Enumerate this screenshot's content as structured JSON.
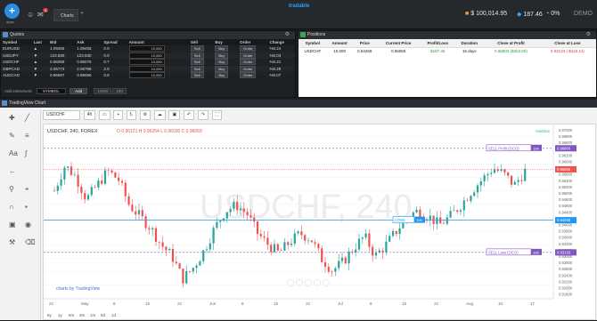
{
  "topbar": {
    "app_label": "apps",
    "notification_count": "3",
    "tab_label": "Charts",
    "brand": "tradable",
    "balance": "$ 100,014.95",
    "equity": "187.46",
    "margin_pct": "0%",
    "mode": "DEMO"
  },
  "quotes": {
    "title": "Quotes",
    "columns": [
      "Symbol",
      "Last",
      "Bid",
      "Ask",
      "Spread",
      "Amount",
      "Sell",
      "Buy",
      "Order",
      "Change"
    ],
    "rows": [
      {
        "symbol": "EURUSD",
        "dir": "up",
        "bid": "1.09455",
        "ask": "1.09455",
        "spread": "0.0",
        "amount": "10,000",
        "change": "%0.24",
        "chg_dir": "up"
      },
      {
        "symbol": "USDJPY",
        "dir": "down",
        "bid": "123.930",
        "ask": "123.930",
        "spread": "0.0",
        "amount": "10,000",
        "change": "%0.03",
        "chg_dir": "up"
      },
      {
        "symbol": "USDCHF",
        "dir": "up",
        "bid": "0.96069",
        "ask": "0.96076",
        "spread": "0.7",
        "amount": "10,000",
        "change": "%0.21",
        "chg_dir": "up"
      },
      {
        "symbol": "GBPCAD",
        "dir": "down",
        "bid": "2.06773",
        "ask": "2.06798",
        "spread": "2.5",
        "amount": "10,000",
        "change": "%0.29",
        "chg_dir": "up"
      },
      {
        "symbol": "AUDCAD",
        "dir": "down",
        "bid": "0.96697",
        "ask": "0.96066",
        "spread": "0.9",
        "amount": "10,000",
        "change": "%0.07",
        "chg_dir": "down"
      }
    ],
    "sell_label": "Sell",
    "buy_label": "Buy",
    "order_label": "Order",
    "add_label": "Add Instrument:",
    "symbol_placeholder": "SYMBOL",
    "add_button": "Add",
    "small_a": "1W40",
    "small_b": "100"
  },
  "positions": {
    "title": "Positions",
    "columns": [
      "Symbol",
      "Amount",
      "Price",
      "Current Price",
      "Profit/Loss",
      "Duration",
      "Close at Profit",
      "Close at Loss"
    ],
    "rows": [
      {
        "symbol": "USDCHF",
        "amount": "10,000",
        "price": "0.94268",
        "current": "0.96065",
        "pl": "$187.46",
        "duration": "15 days",
        "close_profit": "0.96800 ($263.50)",
        "close_loss": "0.93133 (-$118.14)"
      }
    ]
  },
  "chart": {
    "panel_title": "TradingView Chart",
    "symbol_box": "USDCHF",
    "interval": "4h",
    "legend_symbol": "USDCHF, 240, FOREX",
    "ohlc": "O 0.96121  H 0.96254  L 0.96030  C 0.96059",
    "watermark": "USDCHF, 240",
    "realtime_label": "realtime",
    "powered_by": "charts by TradingView",
    "sell_profit_label": "SELL Profit (OCO)",
    "sell_loss_label": "SELL Loss (OCO)",
    "long_label": "LONG",
    "qty": "10K",
    "price_axis": [
      "0.97000",
      "0.96800",
      "0.96600",
      "0.96400",
      "0.96200",
      "0.96000",
      "0.95800",
      "0.95600",
      "0.95400",
      "0.95200",
      "0.95000",
      "0.94800",
      "0.94600",
      "0.94400",
      "0.94200",
      "0.94000",
      "0.93800",
      "0.93600",
      "0.93400",
      "0.93200",
      "0.93000",
      "0.92800",
      "0.92600",
      "0.92400",
      "0.92200",
      "0.92000",
      "0.91800",
      "0.91600"
    ],
    "current_price_tag": "0.96059",
    "profit_price_tag": "0.96800",
    "loss_price_tag": "0.93133",
    "entry_price_tag": "0.94268",
    "time_axis": [
      "22",
      "May",
      "8",
      "15",
      "22",
      "Jun",
      "8",
      "15",
      "22",
      "Jul",
      "8",
      "15",
      "22",
      "Aug",
      "10",
      "17"
    ],
    "periods": [
      "5y",
      "1y",
      "6m",
      "3m",
      "1m",
      "5d",
      "1d"
    ],
    "colors": {
      "up": "#26a69a",
      "down": "#ef5350",
      "profit": "#7e57c2",
      "entry": "#2196f3",
      "current": "#ef5350"
    }
  },
  "chart_data": {
    "type": "candlestick",
    "symbol": "USDCHF",
    "interval": "240",
    "x_range": [
      "Apr 22",
      "Aug 17"
    ],
    "ylim": [
      0.915,
      0.972
    ],
    "close_path": [
      0.953,
      0.962,
      0.958,
      0.95,
      0.955,
      0.96,
      0.957,
      0.948,
      0.944,
      0.94,
      0.934,
      0.93,
      0.922,
      0.926,
      0.932,
      0.94,
      0.946,
      0.948,
      0.945,
      0.938,
      0.934,
      0.931,
      0.935,
      0.938,
      0.936,
      0.929,
      0.925,
      0.928,
      0.933,
      0.937,
      0.93,
      0.934,
      0.939,
      0.944,
      0.946,
      0.944,
      0.941,
      0.944,
      0.948,
      0.953,
      0.957,
      0.961,
      0.959,
      0.955,
      0.96
    ],
    "levels": {
      "close_at_profit": 0.968,
      "entry": 0.94268,
      "close_at_loss": 0.93133,
      "current": 0.96059
    }
  }
}
